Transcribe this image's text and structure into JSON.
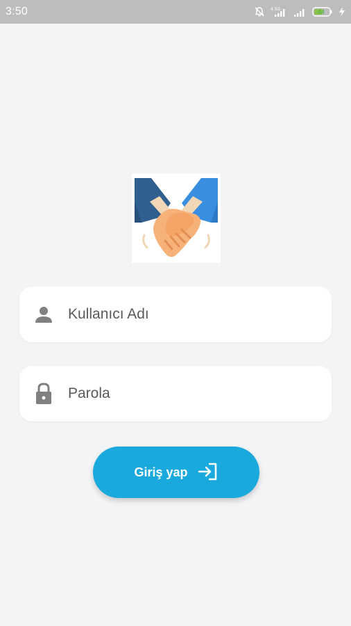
{
  "status_bar": {
    "time": "3:50",
    "network_label": "4.5G",
    "battery_level": "44",
    "icons": [
      "mute-icon",
      "signal-4g-icon",
      "signal-icon",
      "battery-icon",
      "charging-icon"
    ]
  },
  "logo": {
    "icon": "handshake-icon"
  },
  "form": {
    "username": {
      "placeholder": "Kullanıcı Adı",
      "icon": "person-icon"
    },
    "password": {
      "placeholder": "Parola",
      "icon": "lock-icon"
    },
    "submit": {
      "label": "Giriş yap",
      "icon": "login-arrow-icon"
    }
  },
  "colors": {
    "background": "#f3f4f6",
    "status_bar": "#bdbdbd",
    "accent": "#19a9dd",
    "field_bg": "#ffffff",
    "icon_gray": "#808080"
  }
}
